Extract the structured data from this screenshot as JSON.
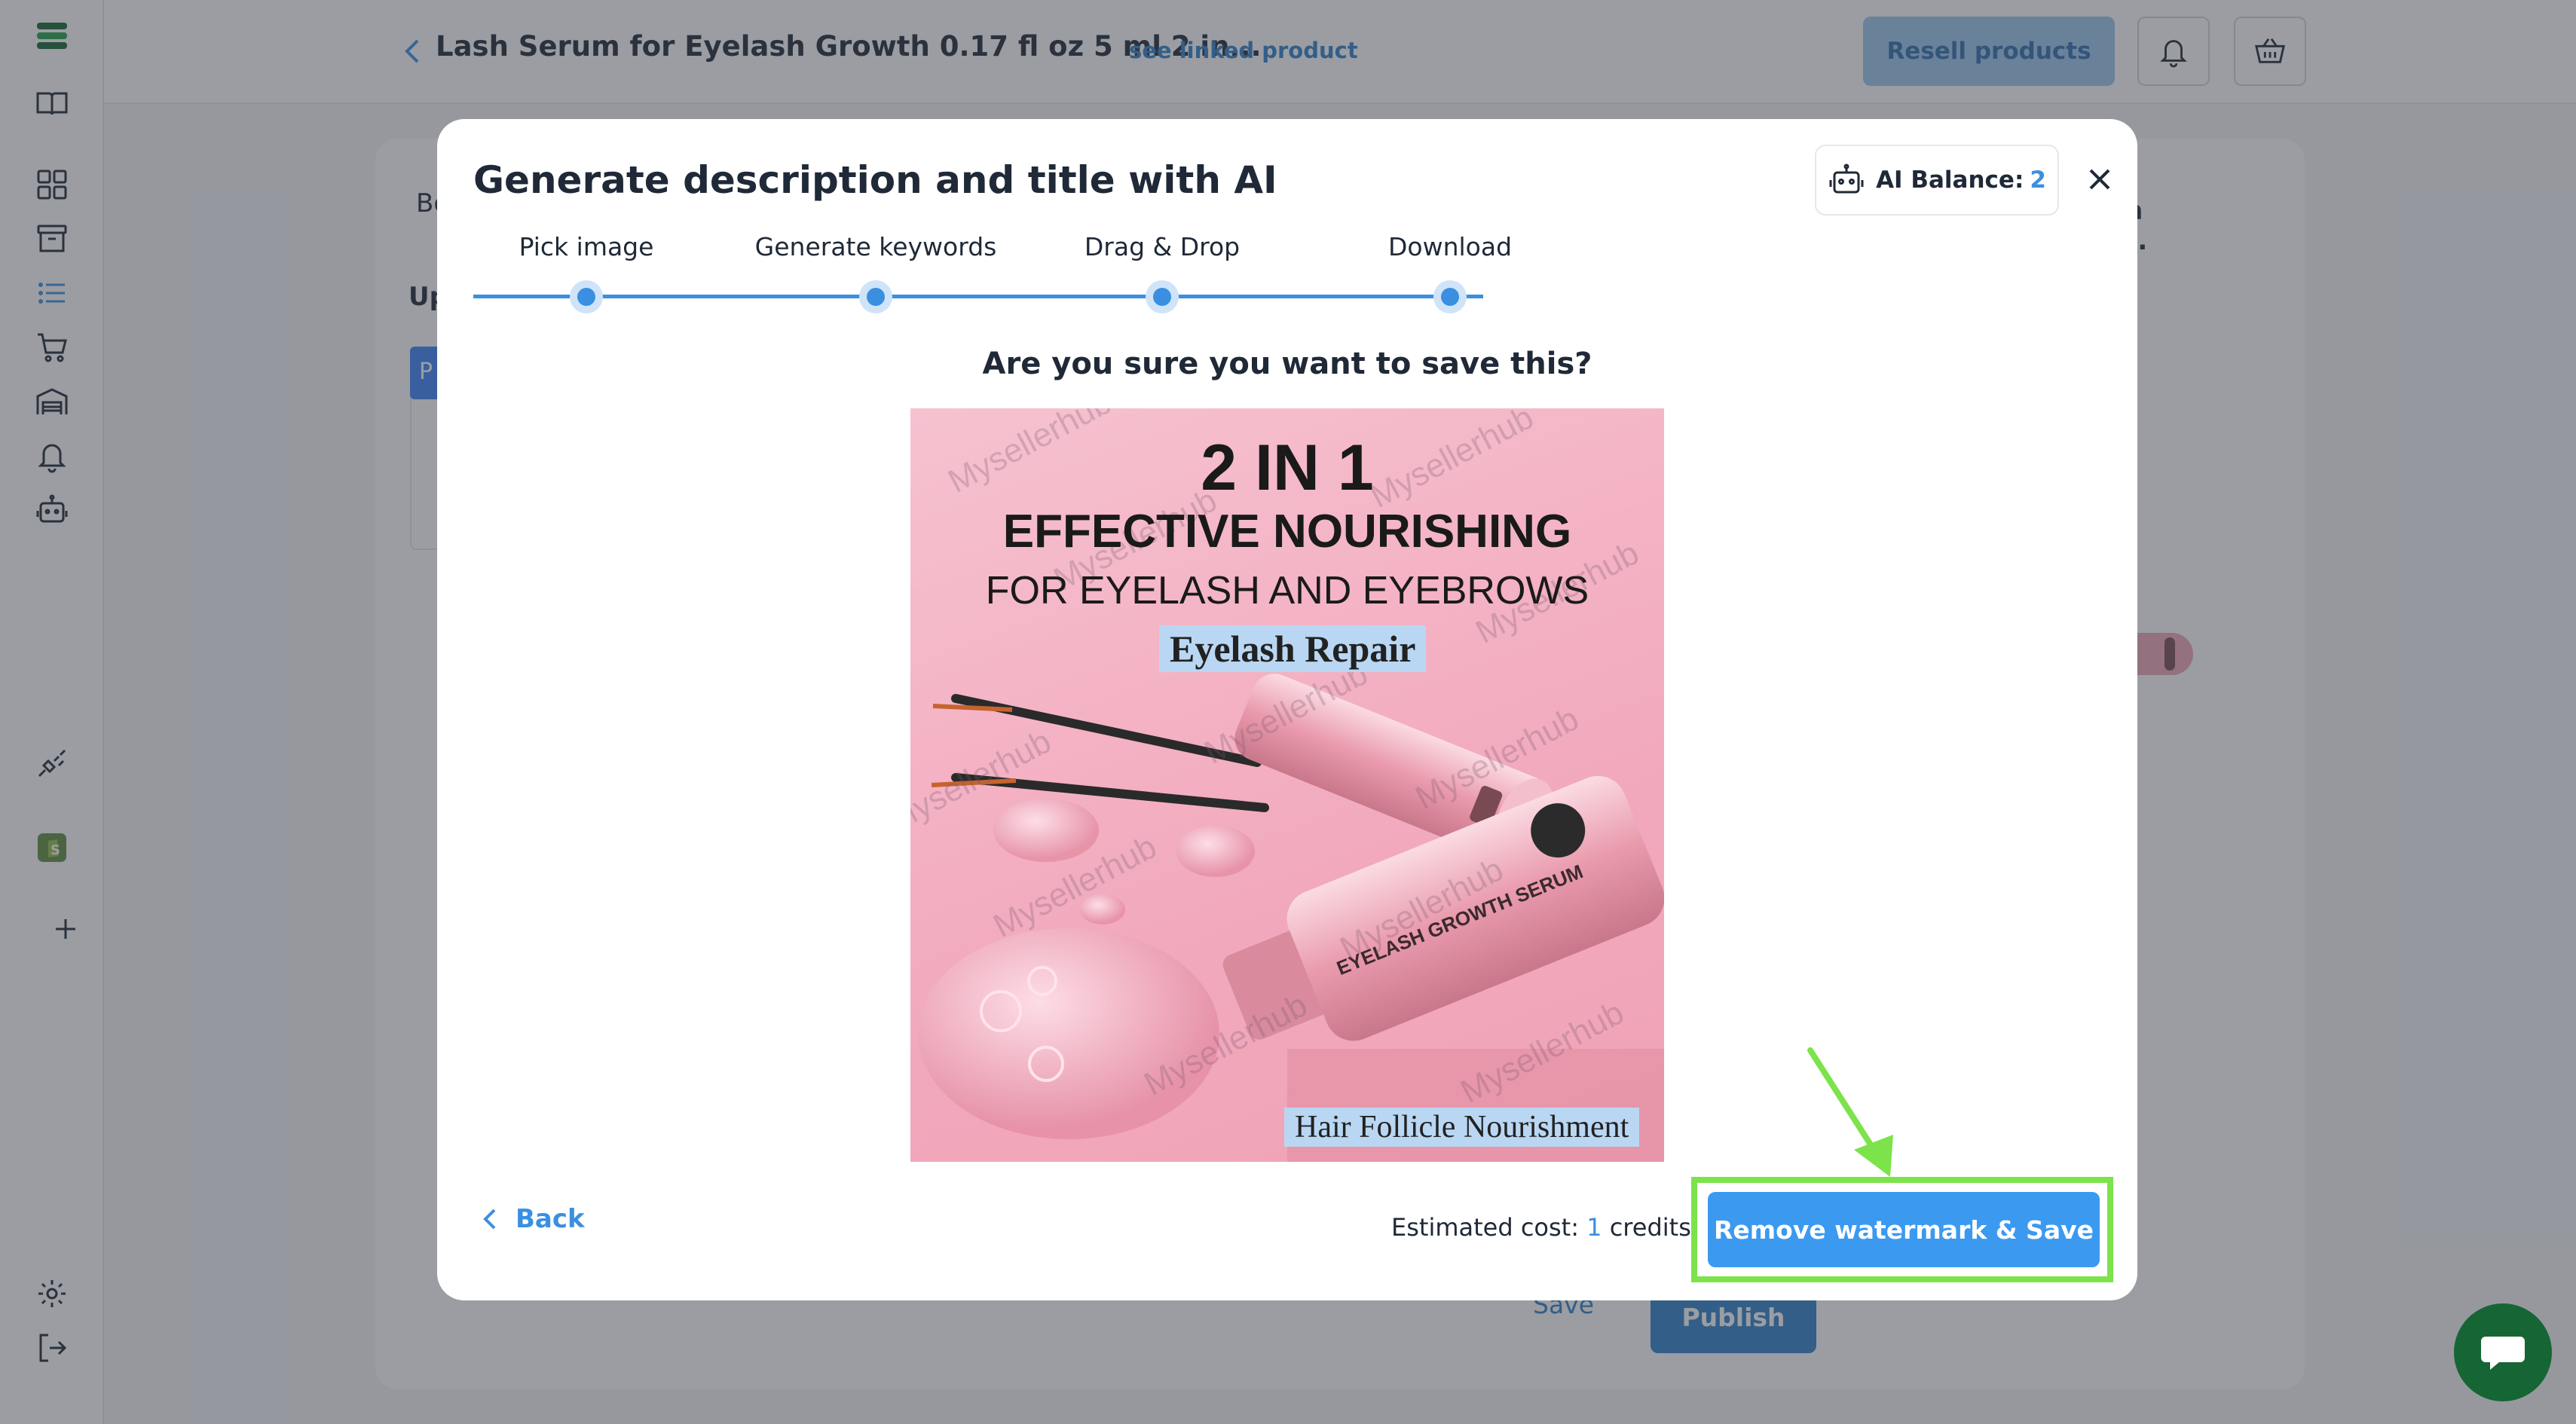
{
  "topbar": {
    "product_title": "Lash Serum for Eyelash Growth 0.17 fl oz 5 ml 2 in...",
    "linked_product_link": "see linked product",
    "resell_button": "Resell products"
  },
  "background": {
    "tab_fragment": "Bo",
    "section_fragment": "Up",
    "panel_title_line1": "ash",
    "panel_title_line2": "al...",
    "blue_tab_fragment": "P",
    "save_label": "Save",
    "publish_label": "Publish"
  },
  "modal": {
    "title": "Generate description and title with AI",
    "ai_balance_label": "AI Balance:",
    "ai_balance_value": "2",
    "steps": [
      {
        "label": "Pick image"
      },
      {
        "label": "Generate keywords"
      },
      {
        "label": "Drag & Drop"
      },
      {
        "label": "Download"
      }
    ],
    "question": "Are you sure you want to save this?",
    "image": {
      "headline": "2 IN 1",
      "subheadline": "EFFECTIVE NOURISHING",
      "tagline": "FOR EYELASH AND EYEBROWS",
      "label_top": "Eyelash Repair",
      "label_bottom": "Hair Follicle Nourishment",
      "watermark": "Mysellerhub",
      "bottle_text": "EYELASH GROWTH SERUM"
    },
    "back_label": "Back",
    "estimated_cost_prefix": "Estimated cost:",
    "estimated_cost_value": "1",
    "estimated_cost_suffix": "credits.",
    "remove_watermark_button": "Remove watermark & Save"
  },
  "colors": {
    "accent": "#3b8fe0",
    "highlight": "#7ce34b",
    "chat_fab": "#166534"
  },
  "icons": [
    "back-chevron-icon",
    "bell-icon",
    "cart-icon",
    "robot-icon",
    "close-icon",
    "chat-icon",
    "logo-icon",
    "book-icon",
    "dashboard-icon",
    "archive-icon",
    "list-icon",
    "store-icon",
    "warehouse-icon",
    "plug-icon",
    "shopify-icon",
    "plus-icon",
    "gear-icon",
    "logout-icon"
  ]
}
